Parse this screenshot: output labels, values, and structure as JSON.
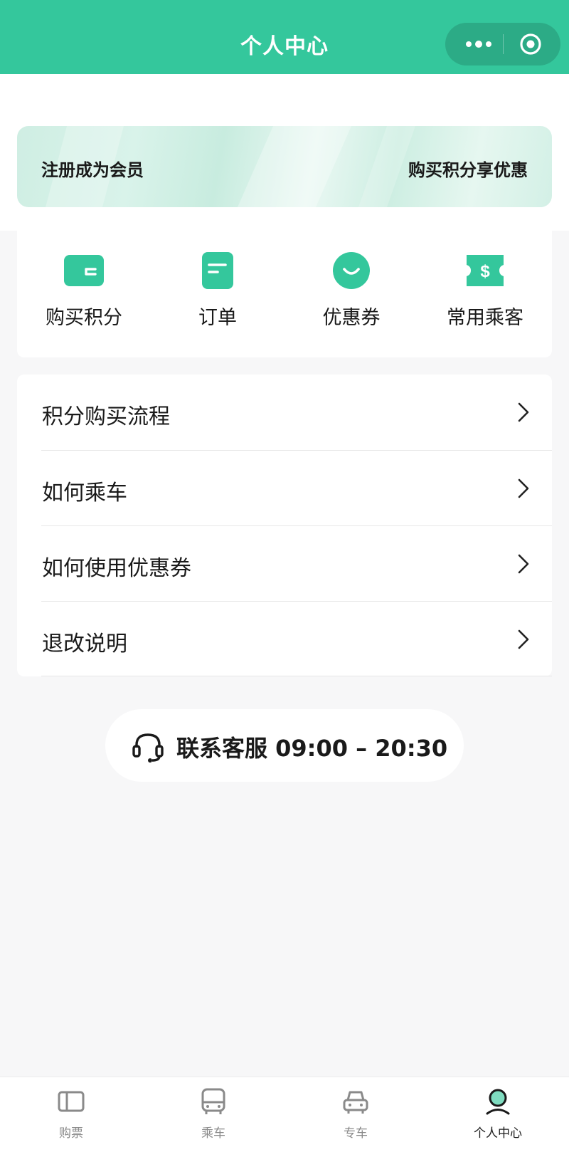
{
  "navbar": {
    "title": "个人中心",
    "capsule_more_icon": "more-dots-icon",
    "capsule_close_icon": "target-close-icon"
  },
  "banner": {
    "left_text": "注册成为会员",
    "right_text": "购买积分享优惠"
  },
  "shortcuts": [
    {
      "label": "购买积分",
      "icon": "wallet-icon"
    },
    {
      "label": "订单",
      "icon": "order-document-icon"
    },
    {
      "label": "优惠券",
      "icon": "smile-coupon-icon"
    },
    {
      "label": "常用乘客",
      "icon": "ticket-dollar-icon"
    }
  ],
  "menu": [
    {
      "label": "积分购买流程"
    },
    {
      "label": "如何乘车"
    },
    {
      "label": "如何使用优惠券"
    },
    {
      "label": "退改说明"
    }
  ],
  "service": {
    "text": "联系客服 09:00 – 20:30",
    "icon": "headset-icon"
  },
  "tabs": [
    {
      "label": "购票",
      "icon": "ticket-icon",
      "active": false
    },
    {
      "label": "乘车",
      "icon": "bus-icon",
      "active": false
    },
    {
      "label": "专车",
      "icon": "car-icon",
      "active": false
    },
    {
      "label": "个人中心",
      "icon": "profile-icon",
      "active": true
    }
  ],
  "colors": {
    "accent": "#34c79c",
    "tab_active": "#1a1a1a",
    "tab_inactive": "#8a8a8a"
  }
}
